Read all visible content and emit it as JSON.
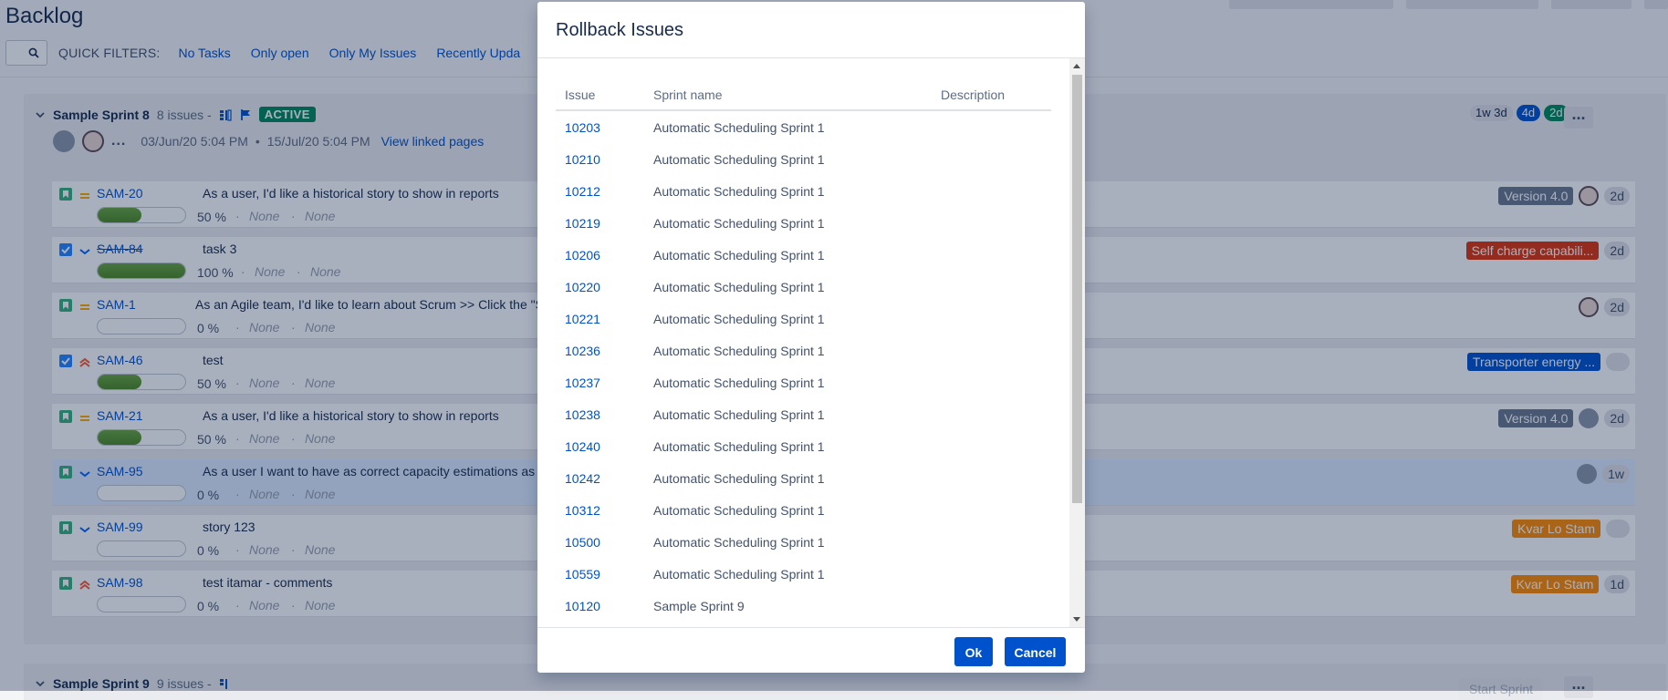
{
  "page": {
    "title": "Backlog"
  },
  "quick_filters": {
    "label": "QUICK FILTERS:",
    "items": [
      "No Tasks",
      "Only open",
      "Only My Issues",
      "Recently Upda"
    ]
  },
  "sprint": {
    "name": "Sample Sprint 8",
    "issue_count": "8 issues -",
    "status": "ACTIVE",
    "start": "03/Jun/20 5:04 PM",
    "separator": "•",
    "end": "15/Jul/20 5:04 PM",
    "linked_pages": "View linked pages",
    "more_dots": "...",
    "estimates": [
      "1w 3d",
      "4d",
      "2d"
    ],
    "more_button": "..."
  },
  "issues": [
    {
      "key": "SAM-20",
      "summary": "As a user, I'd like a historical story to show in reports",
      "progress": 50,
      "progress_label": "50 %",
      "none1": "None",
      "none2": "None",
      "dot": "·",
      "label": "Version 4.0",
      "estimate": "2d",
      "type_color": "#36b37e",
      "priority": "medium",
      "done": false
    },
    {
      "key": "SAM-84",
      "summary": "task 3",
      "progress": 100,
      "progress_label": "100 %",
      "none1": "None",
      "none2": "None",
      "dot": "·",
      "label": "Self charge capabili...",
      "estimate": "2d",
      "type_color": "#2684ff",
      "priority": "low",
      "done": true
    },
    {
      "key": "SAM-1",
      "summary": "As an Agile team, I'd like to learn about Scrum >> Click the \"SAM",
      "progress": 0,
      "progress_label": "0 %",
      "none1": "None",
      "none2": "None",
      "dot": "·",
      "label": "",
      "estimate": "2d",
      "type_color": "#36b37e",
      "priority": "medium",
      "done": false
    },
    {
      "key": "SAM-46",
      "summary": "test",
      "progress": 50,
      "progress_label": "50 %",
      "none1": "None",
      "none2": "None",
      "dot": "·",
      "label": "Transporter energy ...",
      "estimate": "",
      "type_color": "#2684ff",
      "priority": "high",
      "done": false
    },
    {
      "key": "SAM-21",
      "summary": "As a user, I'd like a historical story to show in reports",
      "progress": 50,
      "progress_label": "50 %",
      "none1": "None",
      "none2": "None",
      "dot": "·",
      "label": "Version 4.0",
      "estimate": "2d",
      "type_color": "#36b37e",
      "priority": "medium",
      "done": false
    },
    {
      "key": "SAM-95",
      "summary": "As a user I want to have as correct capacity estimations as possib",
      "progress": 0,
      "progress_label": "0 %",
      "none1": "None",
      "none2": "None",
      "dot": "·",
      "label": "",
      "estimate": "1w",
      "type_color": "#36b37e",
      "priority": "low",
      "done": false
    },
    {
      "key": "SAM-99",
      "summary": "story 123",
      "progress": 0,
      "progress_label": "0 %",
      "none1": "None",
      "none2": "None",
      "dot": "·",
      "label": "Kvar Lo Stam",
      "estimate": "",
      "type_color": "#36b37e",
      "priority": "low",
      "done": false
    },
    {
      "key": "SAM-98",
      "summary": "test itamar - comments",
      "progress": 0,
      "progress_label": "0 %",
      "none1": "None",
      "none2": "None",
      "dot": "·",
      "label": "Kvar Lo Stam",
      "estimate": "1d",
      "type_color": "#36b37e",
      "priority": "high",
      "done": false
    }
  ],
  "sprint9": {
    "name": "Sample Sprint 9",
    "issue_count": "9 issues -",
    "start_button": "Start Sprint",
    "more_button": "..."
  },
  "dialog": {
    "title": "Rollback Issues",
    "columns": [
      "Issue",
      "Sprint name",
      "Description"
    ],
    "rows": [
      {
        "issue": "10203",
        "sprint": "Automatic Scheduling Sprint 1",
        "description": ""
      },
      {
        "issue": "10210",
        "sprint": "Automatic Scheduling Sprint 1",
        "description": ""
      },
      {
        "issue": "10212",
        "sprint": "Automatic Scheduling Sprint 1",
        "description": ""
      },
      {
        "issue": "10219",
        "sprint": "Automatic Scheduling Sprint 1",
        "description": ""
      },
      {
        "issue": "10206",
        "sprint": "Automatic Scheduling Sprint 1",
        "description": ""
      },
      {
        "issue": "10220",
        "sprint": "Automatic Scheduling Sprint 1",
        "description": ""
      },
      {
        "issue": "10221",
        "sprint": "Automatic Scheduling Sprint 1",
        "description": ""
      },
      {
        "issue": "10236",
        "sprint": "Automatic Scheduling Sprint 1",
        "description": ""
      },
      {
        "issue": "10237",
        "sprint": "Automatic Scheduling Sprint 1",
        "description": ""
      },
      {
        "issue": "10238",
        "sprint": "Automatic Scheduling Sprint 1",
        "description": ""
      },
      {
        "issue": "10240",
        "sprint": "Automatic Scheduling Sprint 1",
        "description": ""
      },
      {
        "issue": "10242",
        "sprint": "Automatic Scheduling Sprint 1",
        "description": ""
      },
      {
        "issue": "10312",
        "sprint": "Automatic Scheduling Sprint 1",
        "description": ""
      },
      {
        "issue": "10500",
        "sprint": "Automatic Scheduling Sprint 1",
        "description": ""
      },
      {
        "issue": "10559",
        "sprint": "Automatic Scheduling Sprint 1",
        "description": ""
      },
      {
        "issue": "10120",
        "sprint": "Sample Sprint 9",
        "description": ""
      }
    ],
    "ok_label": "Ok",
    "cancel_label": "Cancel"
  },
  "colors": {
    "link": "#0052cc",
    "active": "#00875a",
    "primary_button": "#0052cc",
    "label_red": "#de350b",
    "label_orange": "#ff8b00",
    "label_gray": "#6b778c"
  }
}
